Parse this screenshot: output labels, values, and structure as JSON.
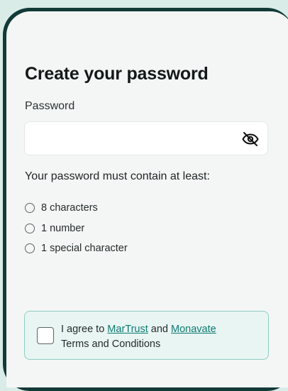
{
  "page": {
    "title": "Create your password"
  },
  "password": {
    "label": "Password",
    "value": "",
    "placeholder": "",
    "toggle_icon": "eye-off-icon"
  },
  "requirements": {
    "title": "Your password must contain at least:",
    "items": [
      {
        "label": "8 characters",
        "met": false
      },
      {
        "label": "1 number",
        "met": false
      },
      {
        "label": "1 special character",
        "met": false
      }
    ]
  },
  "agreement": {
    "checked": false,
    "prefix": "I agree to",
    "link1": "MarTrust",
    "conjunction": "and",
    "link2": "Monavate",
    "suffix": "Terms and Conditions"
  },
  "colors": {
    "accent": "#0d7a72",
    "agree_background": "#e8f5f3",
    "agree_border": "#8fcdc4",
    "device_frame": "#123a36"
  }
}
